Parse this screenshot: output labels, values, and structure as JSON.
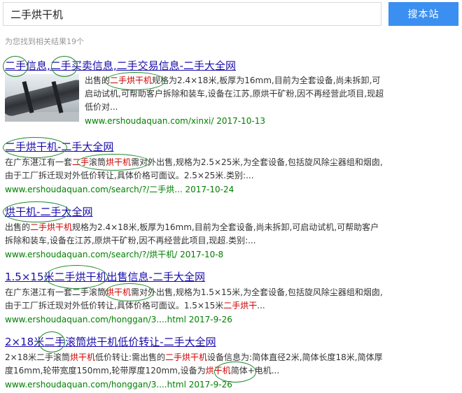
{
  "search": {
    "query": "二手烘干机",
    "button_label": "搜本站"
  },
  "result_count": "为您找到相关结果19个",
  "results": [
    {
      "title": [
        "二手",
        "信息,",
        "二手",
        "买卖信息,二手交易信息-二手大全网"
      ],
      "desc": [
        "出售的",
        "二手烘干机",
        "规格为2.4×18米,板厚为16mm,目前为全套设备,尚未拆卸,可启动试机,可帮助客户拆除和装车,设备在江苏,原烘干矿粉,因不再经营此项目,现超低价对..."
      ],
      "url": "www.ershoudaquan.com/xinxi/ 2017-10-13"
    },
    {
      "title": [
        "二手烘干机",
        "-二手大全网"
      ],
      "desc": [
        "在广东湛江有一套",
        "二手",
        "滚筒",
        "烘干机",
        "需对外出售,规格为2.5×25米,为全套设备,包括旋风除尘器组和烟囱,由于工厂拆迁现对外低价转让,具体价格可面议。2.5×25米.类别:..."
      ],
      "url": "www.ershoudaquan.com/search/?/二手烘... 2017-10-24"
    },
    {
      "title": [
        "烘干机",
        "-",
        "二手",
        "大全网"
      ],
      "desc": [
        "出售的",
        "二手烘干机",
        "规格为2.4×18米,板厚为16mm,目前为全套设备,尚未拆卸,可启动试机,可帮助客户拆除和装车,设备在江苏,原烘干矿粉,因不再经营此项目,现超.类别:..."
      ],
      "url": "www.ershoudaquan.com/search/?/烘干机/ 2017-10-8"
    },
    {
      "title": [
        "1.5×15米",
        "二手烘干机",
        "出售信息-二手大全网"
      ],
      "desc": [
        "在广东湛江有一套二手滚筒",
        "烘干机",
        "需对外出售,规格为1.5×15米,为全套设备,包括旋风除尘器组和烟囱,由于工厂拆迁现对外低价转让,具体价格可面议。1.5×15米",
        "二手烘干",
        "..."
      ],
      "url": "www.ershoudaquan.com/honggan/3....html 2017-9-26"
    },
    {
      "title": [
        "2×18米",
        "二手",
        "滚筒",
        "烘干机",
        "低价转让-二手大全网"
      ],
      "desc": [
        "2×18米二手滚筒",
        "烘干机",
        "低价转让:需出售的",
        "二手烘干机",
        "设备信息为:简体直径2米,简体长度18米,简体厚度16mm,轮带宽度150mm,轮带厚度120mm,设备为",
        "烘干机",
        "简体+电机..."
      ],
      "url": "www.ershoudaquan.com/honggan/3....html 2017-9-26"
    }
  ],
  "colors": {
    "link": "#1a0dab",
    "highlight": "#cc0000",
    "url": "#008000",
    "button": "#3b8ff0",
    "annotation_circle": "#1d8a2a"
  }
}
